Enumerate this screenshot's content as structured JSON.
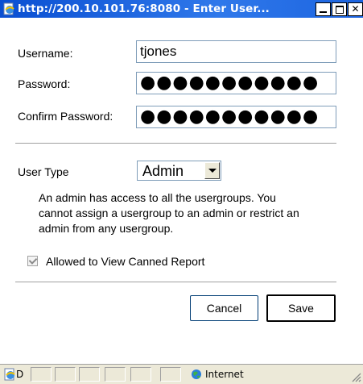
{
  "window": {
    "title": "http://200.10.101.76:8080 - Enter User...",
    "title_icon": "ie-page-icon",
    "min_label": "",
    "max_label": "",
    "close_label": "✕"
  },
  "form": {
    "username_label": "Username:",
    "username_value": "tjones",
    "password_label": "Password:",
    "password_value": "●●●●●●●●●●●",
    "confirm_label": "Confirm Password:",
    "confirm_value": "●●●●●●●●●●●",
    "usertype_label": "User Type",
    "usertype_value": "Admin",
    "description": "An admin has access to all the usergroups. You cannot assign a usergroup to an admin or restrict an admin from any usergroup.",
    "canned_report_label": "Allowed to View Canned Report",
    "canned_report_checked": true,
    "canned_report_disabled": true
  },
  "buttons": {
    "cancel": "Cancel",
    "save": "Save"
  },
  "statusbar": {
    "text": "D",
    "zone": "Internet"
  },
  "colors": {
    "titlebar": "#1c64e0",
    "border": "#7f9db9",
    "statusbar": "#ece9d8"
  }
}
